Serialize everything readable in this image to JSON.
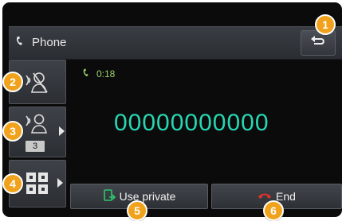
{
  "header": {
    "title": "Phone",
    "phone_icon": "phone-handset-icon",
    "back_icon": "back-arrow-icon"
  },
  "side_buttons": {
    "mic_mute_icon": "mic-mute-icon",
    "volume_icon": "mic-volume-icon",
    "volume_level": "3",
    "keypad_icon": "dial-keypad-icon"
  },
  "call": {
    "timer": "0:18",
    "number": "00000000000"
  },
  "bottom_buttons": {
    "use_private": "Use private",
    "end": "End"
  },
  "markers": [
    "1",
    "2",
    "3",
    "4",
    "5",
    "6"
  ],
  "colors": {
    "number": "#27d7b2",
    "timer": "#9bd36b",
    "marker": "#f0a21d",
    "end_icon": "#e0322a",
    "private_icon": "#2cc66a"
  }
}
